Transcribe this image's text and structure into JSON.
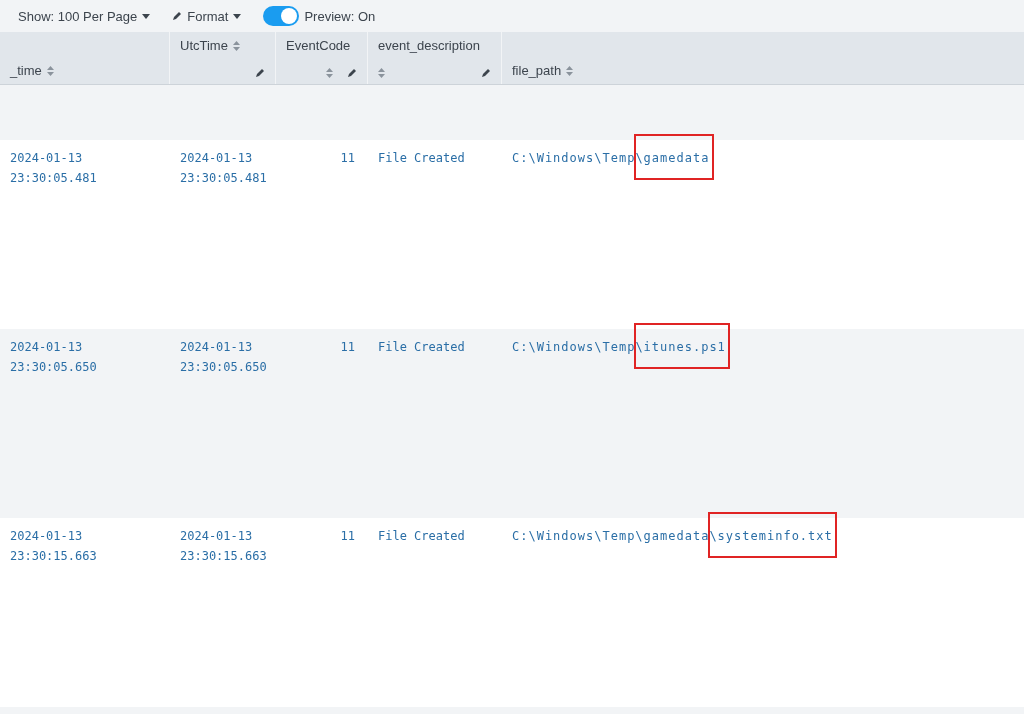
{
  "toolbar": {
    "page_size": "Show: 100 Per Page",
    "format": "Format",
    "preview": {
      "label": "Preview: On",
      "on": true
    }
  },
  "table": {
    "columns": [
      {
        "label": "_time",
        "editable": false
      },
      {
        "label": "UtcTime",
        "editable": true
      },
      {
        "label": "EventCode",
        "editable": true
      },
      {
        "label": "event_description",
        "editable": true
      },
      {
        "label": "file_path",
        "editable": false
      }
    ],
    "rows": [
      {
        "time": [
          "2024-01-13",
          "23:30:05.481"
        ],
        "utc": [
          "2024-01-13",
          "23:30:05.481"
        ],
        "code": "11",
        "description": "File Created",
        "file_path": {
          "start": "C:\\Windows\\Temp",
          "highlighted": "\\gamedata"
        }
      },
      {
        "time": [
          "2024-01-13",
          "23:30:05.650"
        ],
        "utc": [
          "2024-01-13",
          "23:30:05.650"
        ],
        "code": "11",
        "description": "File Created",
        "file_path": {
          "start": "C:\\Windows\\Temp",
          "highlighted": "\\itunes.ps1"
        }
      },
      {
        "time": [
          "2024-01-13",
          "23:30:15.663"
        ],
        "utc": [
          "2024-01-13",
          "23:30:15.663"
        ],
        "code": "11",
        "description": "File Created",
        "file_path": {
          "start": "C:\\Windows\\Temp\\gamedata",
          "highlighted": "\\systeminfo.txt"
        }
      }
    ]
  }
}
